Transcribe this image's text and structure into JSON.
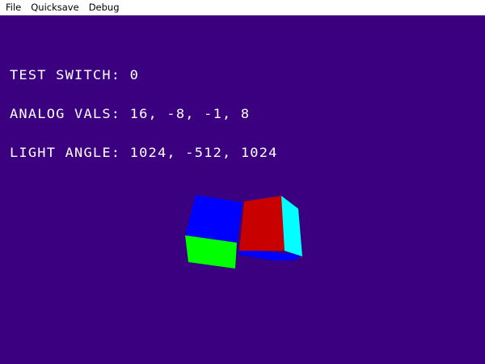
{
  "menu": {
    "items": [
      {
        "label": "File"
      },
      {
        "label": "Quicksave"
      },
      {
        "label": "Debug"
      }
    ]
  },
  "screen": {
    "background_color": "#3a0080"
  },
  "hud": {
    "test_switch": "TEST SWITCH: 0",
    "analog_vals": "ANALOG VALS: 16, -8, -1, 8",
    "light_angle": "LIGHT ANGLE: 1024, -512, 1024"
  },
  "scene": {
    "colors": {
      "blue": "#0000ff",
      "red": "#c80000",
      "green": "#00ff00",
      "cyan": "#00ffff"
    }
  }
}
